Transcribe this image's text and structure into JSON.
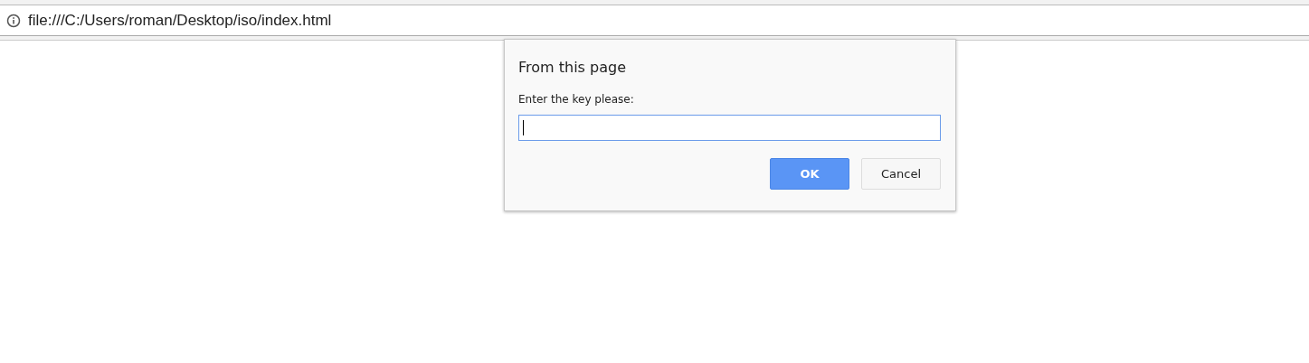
{
  "address_bar": {
    "url": "file:///C:/Users/roman/Desktop/iso/index.html"
  },
  "dialog": {
    "title": "From this page",
    "message": "Enter the key please:",
    "input": {
      "focused": true
    },
    "buttons": [
      {
        "label": "OK",
        "kind": "primary"
      },
      {
        "label": "Cancel",
        "kind": "secondary"
      }
    ]
  }
}
